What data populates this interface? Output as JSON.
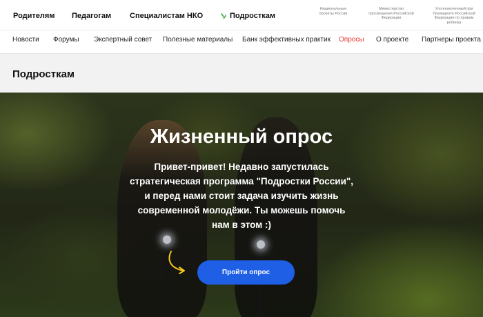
{
  "audience_nav": [
    "Родителям",
    "Педагогам",
    "Специалистам НКО",
    "Подросткам"
  ],
  "partners": [
    "Национальные проекты России",
    "Министерство просвещения Российской Федерации",
    "Уполномоченный при Президенте Российской Федерации по правам ребенка"
  ],
  "main_nav": [
    "Новости",
    "Форумы",
    "Экспертный совет",
    "Полезные материалы",
    "Банк эффективных практик",
    "Опросы",
    "О проекте",
    "Партнеры проекта"
  ],
  "page_title": "Подросткам",
  "hero": {
    "title": "Жизненный опрос",
    "text": "Привет-привет! Недавно запустилась стратегическая программа \"Подростки России\", и перед нами стоит задача изучить жизнь современной молодёжи. Ты можешь помочь нам в этом :)",
    "cta": "Пройти опрос"
  },
  "colors": {
    "accent_nav": "#e5322d",
    "cta": "#1f5fe6",
    "leaf_green": "#3fae49",
    "arrow": "#f5c518"
  }
}
